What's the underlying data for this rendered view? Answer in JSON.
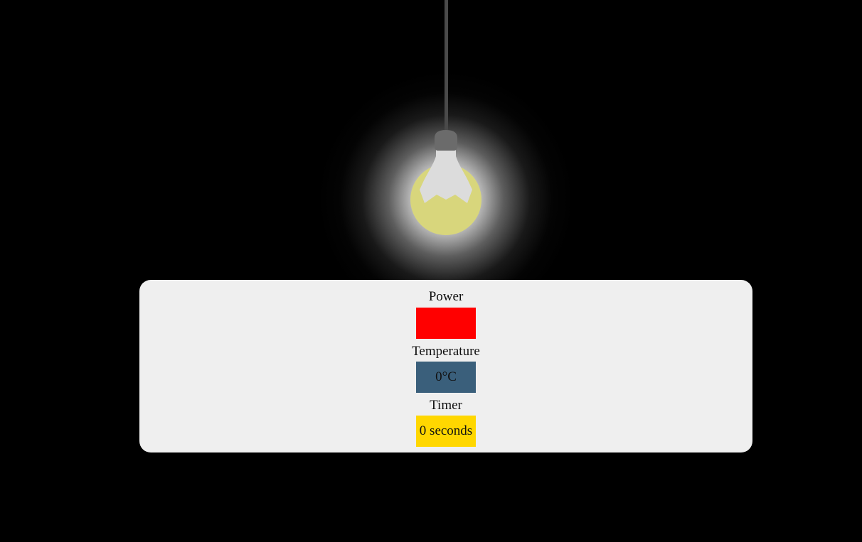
{
  "colors": {
    "background": "#000000",
    "panel": "#efefef",
    "cord": "#4a4a4a",
    "bulb_cap": "#6b6b6b",
    "bulb_neck": "#dcdcdc",
    "bulb_glass": "#d8d67c",
    "power": "#ff0000",
    "temperature": "#3a5f7b",
    "timer": "#ffd700"
  },
  "light": {
    "icon": "light-bulb-icon",
    "state": "on"
  },
  "controls": {
    "power": {
      "label": "Power",
      "value": ""
    },
    "temperature": {
      "label": "Temperature",
      "value": "0°C"
    },
    "timer": {
      "label": "Timer",
      "value": "0 seconds"
    }
  }
}
